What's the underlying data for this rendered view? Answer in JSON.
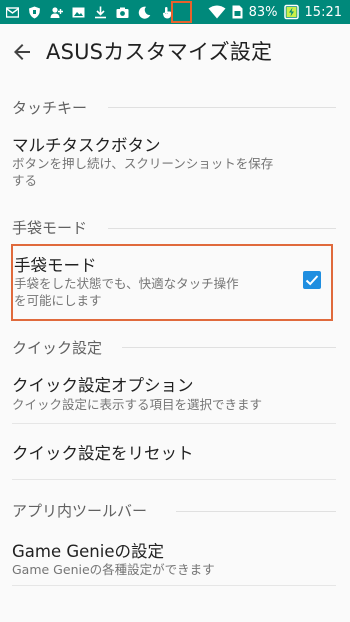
{
  "status_bar": {
    "battery_percent": "83%",
    "time": "15:21",
    "left_icons": [
      "mail-icon",
      "shield-icon",
      "person-add-icon",
      "image-icon",
      "download-icon",
      "camera-icon",
      "moon-icon",
      "touch-icon"
    ],
    "right_icons": [
      "wifi-icon",
      "sim-icon",
      "battery-icon"
    ]
  },
  "app_bar": {
    "title": "ASUSカスタマイズ設定",
    "back_icon": "arrow-back-icon"
  },
  "sections": {
    "touch_key": {
      "header": "タッチキー",
      "item_title": "マルチタスクボタン",
      "item_subtitle_line1": "ボタンを押し続け、スクリーンショットを保存",
      "item_subtitle_line2": "する"
    },
    "glove_mode": {
      "header": "手袋モード",
      "item_title": "手袋モード",
      "item_subtitle_line1": "手袋をした状態でも、快適なタッチ操作",
      "item_subtitle_line2": "を可能にします",
      "checked": true
    },
    "quick_settings": {
      "header": "クイック設定",
      "option_title": "クイック設定オプション",
      "option_subtitle": "クイック設定に表示する項目を選択できます",
      "reset_title": "クイック設定をリセット"
    },
    "in_app_toolbar": {
      "header": "アプリ内ツールバー",
      "item_title": "Game Genieの設定",
      "item_subtitle": "Game Genieの各種設定ができます"
    }
  },
  "colors": {
    "status_bar": "#00897b",
    "accent": "#1f8ee0",
    "highlight": "#e06a3c"
  }
}
